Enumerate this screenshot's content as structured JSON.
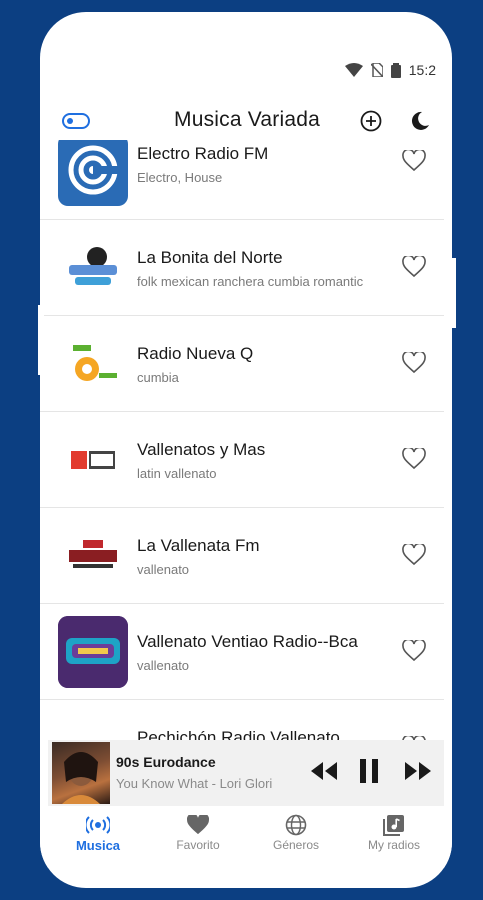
{
  "status": {
    "time": "15:2"
  },
  "app": {
    "title": "Musica Variada"
  },
  "stations": [
    {
      "name": "Electro Radio FM",
      "tags": "Electro, House",
      "logo": "electro-radio-logo"
    },
    {
      "name": "La Bonita del Norte",
      "tags": "folk mexican ranchera cumbia romantic",
      "logo": "la-bonita-logo"
    },
    {
      "name": "Radio Nueva Q",
      "tags": "cumbia",
      "logo": "nueva-q-logo"
    },
    {
      "name": "Vallenatos y Mas",
      "tags": "latin vallenato",
      "logo": "vym-logo"
    },
    {
      "name": "La Vallenata Fm",
      "tags": "vallenato",
      "logo": "la-vallenata-logo"
    },
    {
      "name": "Vallenato Ventiao Radio--Bca",
      "tags": "vallenato",
      "logo": "ventiao-logo"
    },
    {
      "name": "Pechichón Radio Vallenato",
      "tags": "",
      "logo": "pechichon-logo"
    }
  ],
  "player": {
    "title": "90s Eurodance",
    "subtitle": "You Know What - Lori Glori",
    "cover": "album-cover"
  },
  "nav": [
    {
      "label": "Musica",
      "icon": "radio-broadcast-icon",
      "active": true
    },
    {
      "label": "Favorito",
      "icon": "heart-icon"
    },
    {
      "label": "Géneros",
      "icon": "globe-icon"
    },
    {
      "label": "My radios",
      "icon": "music-library-icon"
    }
  ],
  "colors": {
    "accent": "#1f6fe0",
    "background": "#0c3f82"
  }
}
